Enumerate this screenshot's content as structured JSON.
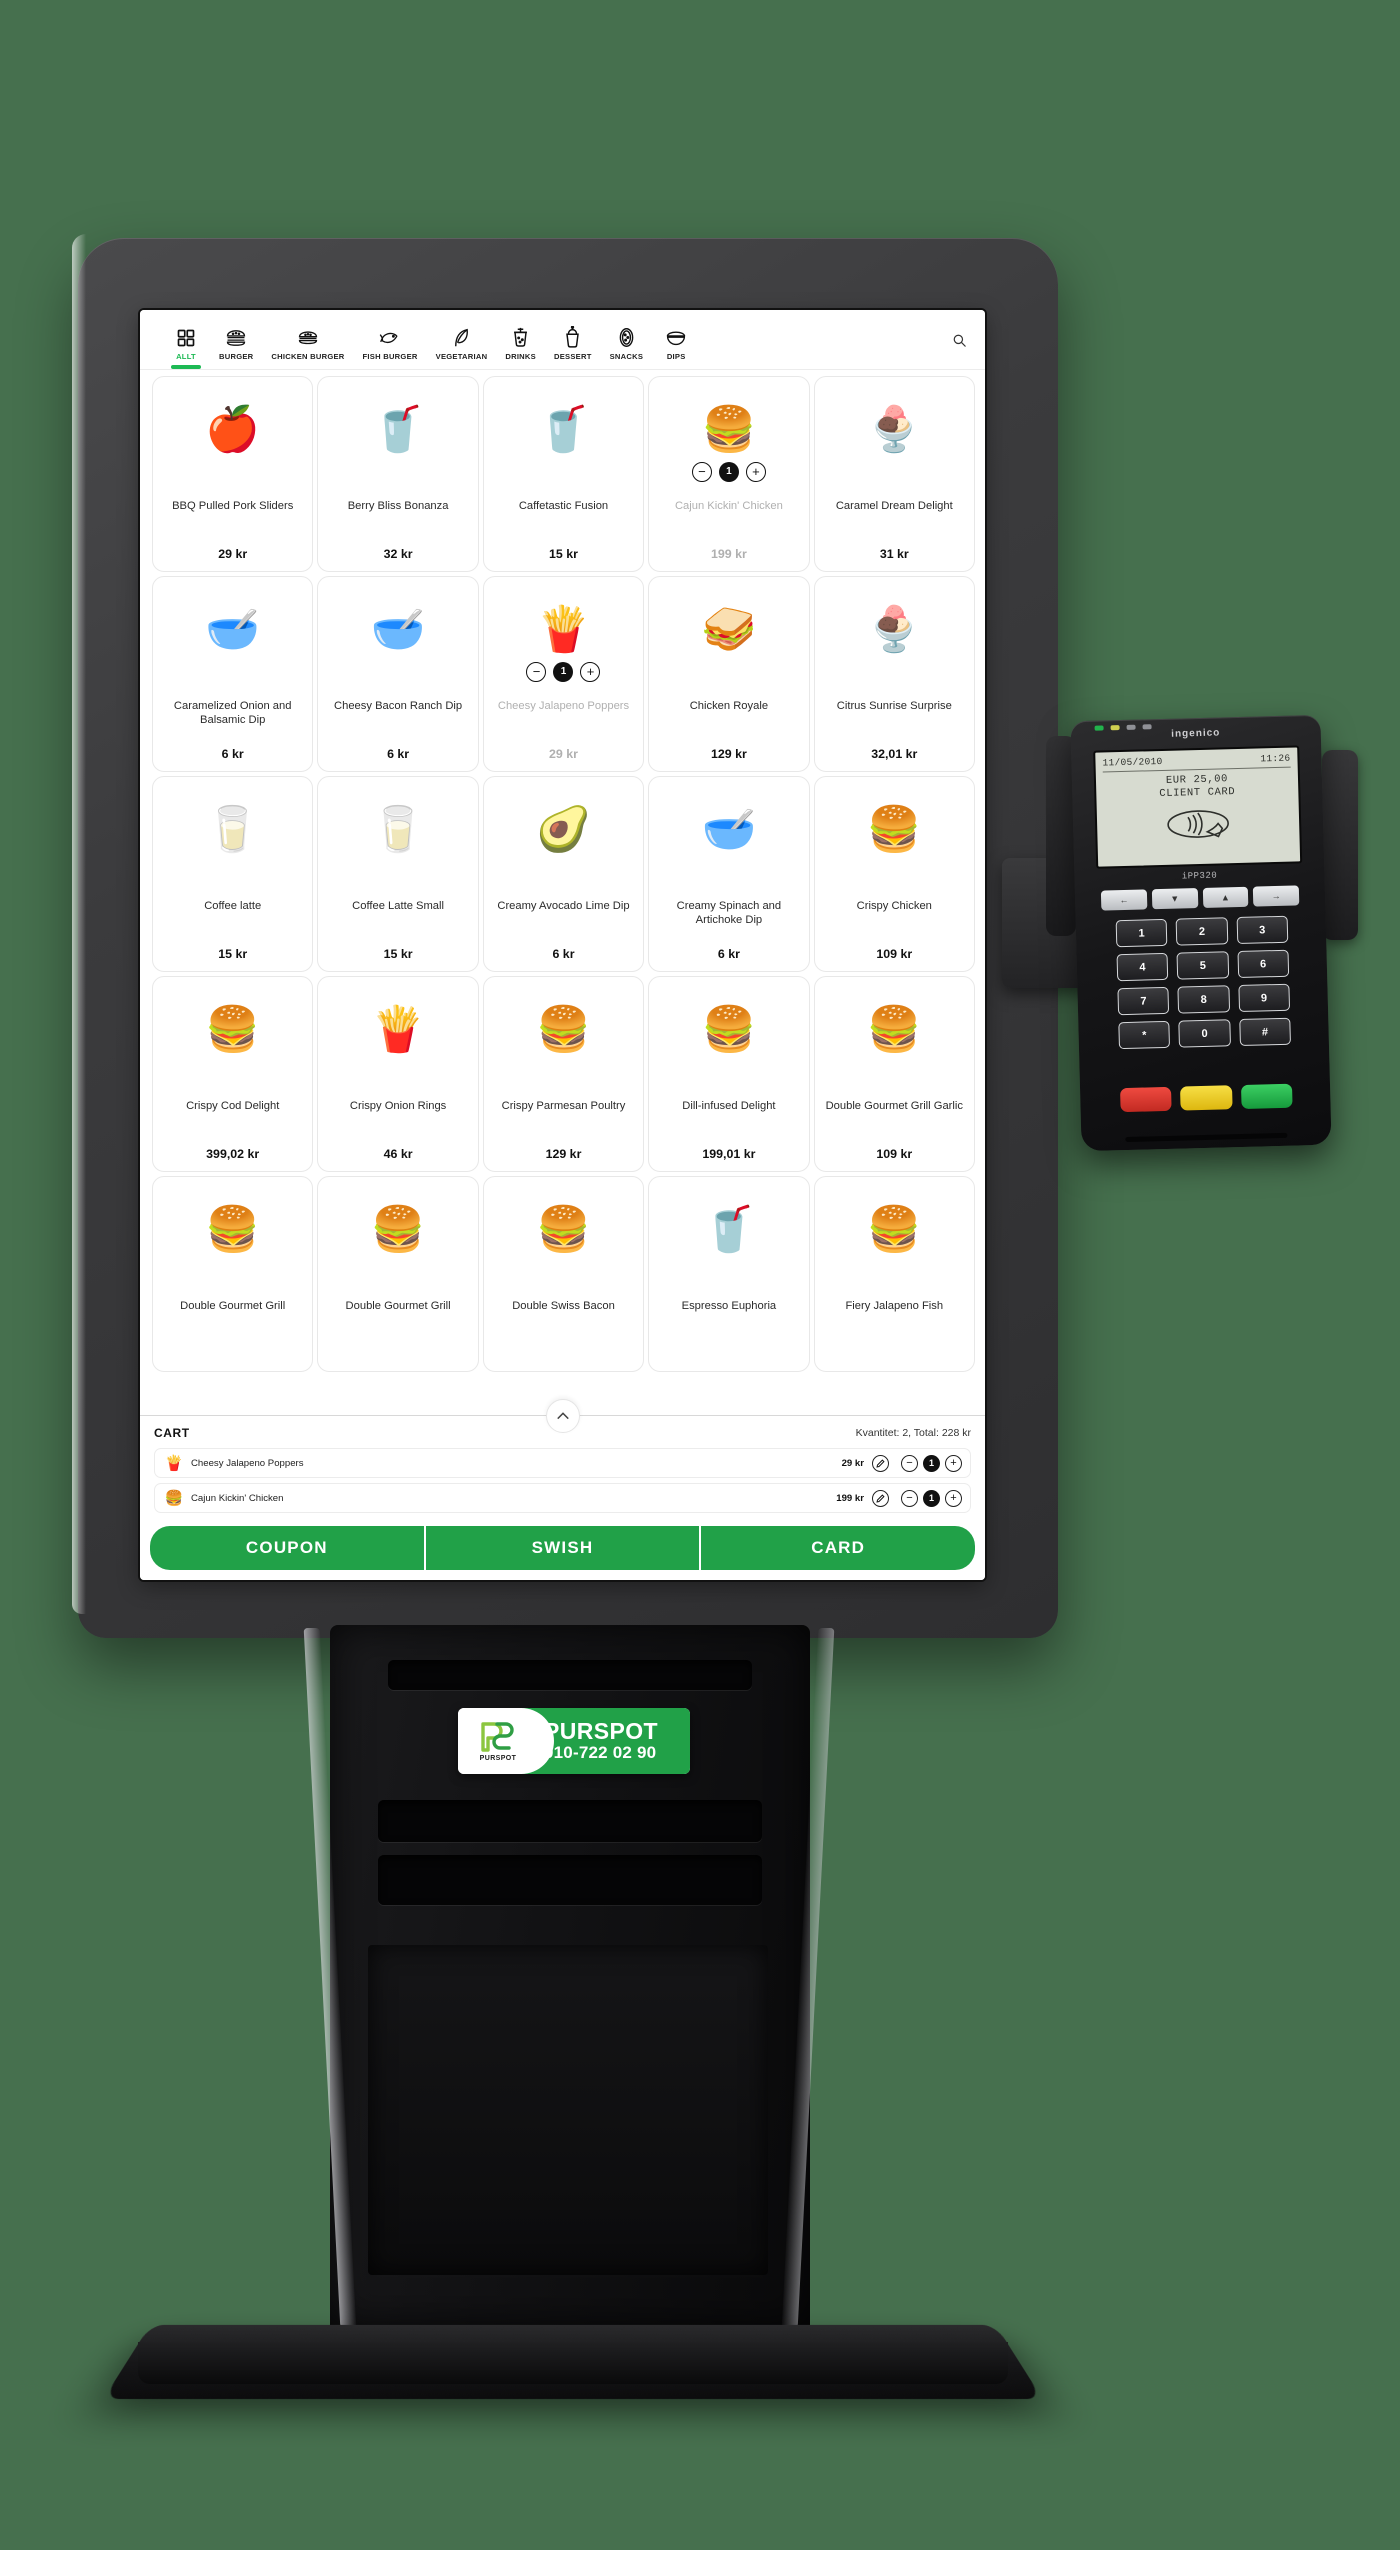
{
  "background_color": "#46704e",
  "accent_green": "#21a148",
  "active_tab_green": "#1db954",
  "nav": {
    "search_icon": "search-icon",
    "tabs": [
      {
        "label": "ALLT",
        "icon": "grid-icon",
        "active": true
      },
      {
        "label": "BURGER",
        "icon": "burger-icon",
        "active": false
      },
      {
        "label": "CHICKEN BURGER",
        "icon": "chicken-burger-icon",
        "active": false
      },
      {
        "label": "FISH BURGER",
        "icon": "fish-icon",
        "active": false
      },
      {
        "label": "VEGETARIAN",
        "icon": "leaf-icon",
        "active": false
      },
      {
        "label": "DRINKS",
        "icon": "cup-icon",
        "active": false
      },
      {
        "label": "DESSERT",
        "icon": "sundae-icon",
        "active": false
      },
      {
        "label": "SNACKS",
        "icon": "snack-icon",
        "active": false
      },
      {
        "label": "DIPS",
        "icon": "dip-bowl-icon",
        "active": false
      }
    ]
  },
  "products": [
    {
      "name": "BBQ Pulled Pork Sliders",
      "price": "29 kr",
      "emoji": "🍎",
      "selected": false,
      "qty": null
    },
    {
      "name": "Berry Bliss Bonanza",
      "price": "32 kr",
      "emoji": "🥤",
      "selected": false,
      "qty": null
    },
    {
      "name": "Caffetastic Fusion",
      "price": "15 kr",
      "emoji": "🥤",
      "selected": false,
      "qty": null
    },
    {
      "name": "Cajun Kickin' Chicken",
      "price": "199 kr",
      "emoji": "🍔",
      "selected": true,
      "qty": "1"
    },
    {
      "name": "Caramel Dream Delight",
      "price": "31 kr",
      "emoji": "🍨",
      "selected": false,
      "qty": null
    },
    {
      "name": "Caramelized Onion and Balsamic Dip",
      "price": "6 kr",
      "emoji": "🥣",
      "selected": false,
      "qty": null
    },
    {
      "name": "Cheesy Bacon Ranch Dip",
      "price": "6 kr",
      "emoji": "🥣",
      "selected": false,
      "qty": null
    },
    {
      "name": "Cheesy Jalapeno Poppers",
      "price": "29 kr",
      "emoji": "🍟",
      "selected": true,
      "qty": "1"
    },
    {
      "name": "Chicken Royale",
      "price": "129 kr",
      "emoji": "🥪",
      "selected": false,
      "qty": null
    },
    {
      "name": "Citrus Sunrise Surprise",
      "price": "32,01 kr",
      "emoji": "🍨",
      "selected": false,
      "qty": null
    },
    {
      "name": "Coffee latte",
      "price": "15 kr",
      "emoji": "🥛",
      "selected": false,
      "qty": null
    },
    {
      "name": "Coffee Latte Small",
      "price": "15 kr",
      "emoji": "🥛",
      "selected": false,
      "qty": null
    },
    {
      "name": "Creamy Avocado Lime Dip",
      "price": "6 kr",
      "emoji": "🥑",
      "selected": false,
      "qty": null
    },
    {
      "name": "Creamy Spinach and Artichoke Dip",
      "price": "6 kr",
      "emoji": "🥣",
      "selected": false,
      "qty": null
    },
    {
      "name": "Crispy Chicken",
      "price": "109 kr",
      "emoji": "🍔",
      "selected": false,
      "qty": null
    },
    {
      "name": "Crispy Cod Delight",
      "price": "399,02 kr",
      "emoji": "🍔",
      "selected": false,
      "qty": null
    },
    {
      "name": "Crispy Onion Rings",
      "price": "46 kr",
      "emoji": "🍟",
      "selected": false,
      "qty": null
    },
    {
      "name": "Crispy Parmesan Poultry",
      "price": "129 kr",
      "emoji": "🍔",
      "selected": false,
      "qty": null
    },
    {
      "name": "Dill-infused Delight",
      "price": "199,01 kr",
      "emoji": "🍔",
      "selected": false,
      "qty": null
    },
    {
      "name": "Double Gourmet Grill Garlic",
      "price": "109 kr",
      "emoji": "🍔",
      "selected": false,
      "qty": null
    },
    {
      "name": "Double Gourmet Grill",
      "price": "",
      "emoji": "🍔",
      "selected": false,
      "qty": null
    },
    {
      "name": "Double Gourmet Grill",
      "price": "",
      "emoji": "🍔",
      "selected": false,
      "qty": null
    },
    {
      "name": "Double Swiss Bacon",
      "price": "",
      "emoji": "🍔",
      "selected": false,
      "qty": null
    },
    {
      "name": "Espresso Euphoria",
      "price": "",
      "emoji": "🥤",
      "selected": false,
      "qty": null
    },
    {
      "name": "Fiery Jalapeno Fish",
      "price": "",
      "emoji": "🍔",
      "selected": false,
      "qty": null
    }
  ],
  "cart": {
    "title": "CART",
    "summary_label": "Kvantitet:",
    "summary_qty": "2",
    "summary_total_label": "Total:",
    "summary_total": "228 kr",
    "summary_text": "Kvantitet: 2, Total: 228 kr",
    "collapse_icon": "chevron-up-icon",
    "items": [
      {
        "name": "Cheesy Jalapeno Poppers",
        "price": "29 kr",
        "qty": "1",
        "emoji": "🍟",
        "edit_icon": "pencil-icon"
      },
      {
        "name": "Cajun Kickin' Chicken",
        "price": "199 kr",
        "qty": "1",
        "emoji": "🍔",
        "edit_icon": "pencil-icon"
      }
    ]
  },
  "payment_buttons": [
    {
      "label": "COUPON"
    },
    {
      "label": "SWISH"
    },
    {
      "label": "CARD"
    }
  ],
  "brand_plate": {
    "logo_mark": "purspot-logo",
    "logo_caption": "PURSPOT",
    "name": "PURSPOT",
    "phone": "010-722 02 90"
  },
  "terminal": {
    "brand": "ingenico",
    "screen": {
      "date": "11/05/2010",
      "time": "11:26",
      "amount": "EUR 25,00",
      "label": "CLIENT CARD",
      "contactless_icon": "contactless-wave-icon"
    },
    "model": "iPP320",
    "function_keys": [
      "←",
      "▼",
      "▲",
      "→"
    ],
    "keys": [
      "1",
      "2",
      "3",
      "4",
      "5",
      "6",
      "7",
      "8",
      "9",
      "*",
      "0",
      "#"
    ],
    "control_keys": [
      {
        "name": "cancel-key",
        "color": "#e0342c"
      },
      {
        "name": "correct-key",
        "color": "#f2d024"
      },
      {
        "name": "confirm-key",
        "color": "#22b24c"
      }
    ],
    "status_lights": [
      "#22b24c",
      "#cfcf50",
      "#8f9096",
      "#8f9096"
    ]
  }
}
